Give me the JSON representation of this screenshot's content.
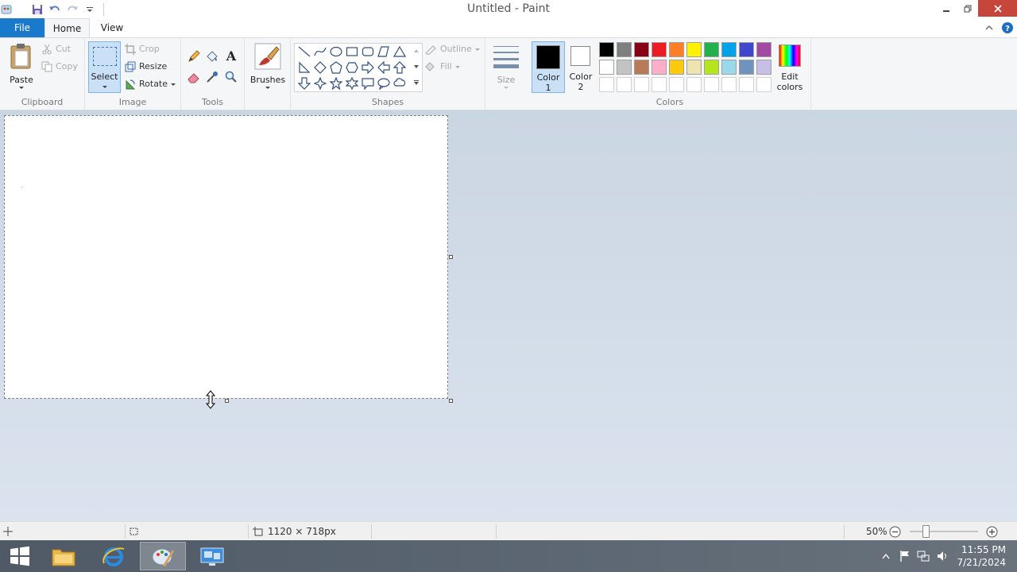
{
  "window": {
    "title": "Untitled - Paint"
  },
  "tabs": {
    "file": "File",
    "home": "Home",
    "view": "View"
  },
  "clipboard": {
    "paste": "Paste",
    "cut": "Cut",
    "copy": "Copy",
    "label": "Clipboard"
  },
  "image": {
    "select": "Select",
    "crop": "Crop",
    "resize": "Resize",
    "rotate": "Rotate",
    "label": "Image"
  },
  "tools": {
    "label": "Tools"
  },
  "brushes": {
    "label": "Brushes"
  },
  "shapes": {
    "outline": "Outline",
    "fill": "Fill",
    "label": "Shapes"
  },
  "size": {
    "label": "Size"
  },
  "color1": {
    "line1": "Color",
    "line2": "1",
    "value": "#000000"
  },
  "color2": {
    "line1": "Color",
    "line2": "2",
    "value": "#ffffff"
  },
  "colors": {
    "label": "Colors",
    "edit_line1": "Edit",
    "edit_line2": "colors",
    "row1": [
      "#000000",
      "#7f7f7f",
      "#880015",
      "#ed1c24",
      "#ff7f27",
      "#fff200",
      "#22b14c",
      "#00a2e8",
      "#3f48cc",
      "#a349a4"
    ],
    "row2": [
      "#ffffff",
      "#c3c3c3",
      "#b97a57",
      "#ffaec9",
      "#ffc90e",
      "#efe4b0",
      "#b5e61d",
      "#99d9ea",
      "#7092be",
      "#c8bfe7"
    ],
    "row3": [
      "#ffffff",
      "#ffffff",
      "#ffffff",
      "#ffffff",
      "#ffffff",
      "#ffffff",
      "#ffffff",
      "#ffffff",
      "#ffffff",
      "#ffffff"
    ]
  },
  "status": {
    "dimensions": "1120 × 718px",
    "zoom": "50%"
  },
  "clock": {
    "time": "11:55 PM",
    "date": "7/21/2024"
  }
}
